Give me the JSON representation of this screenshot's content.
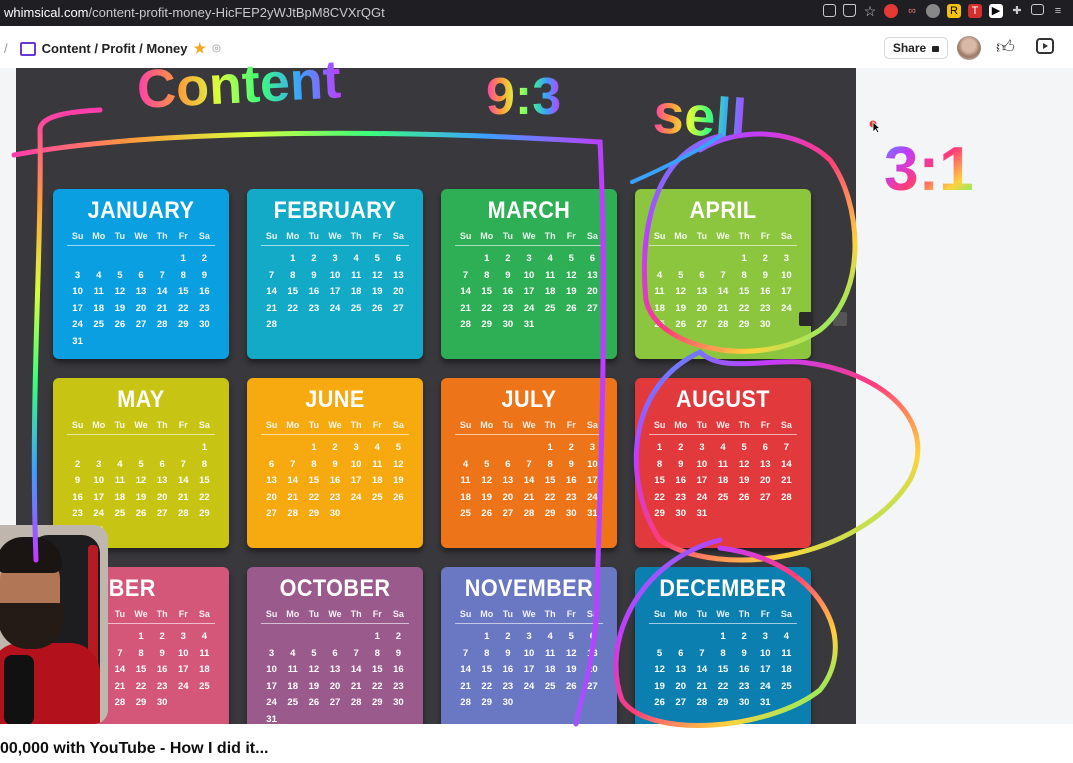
{
  "browser": {
    "url_host": "whimsical.com",
    "url_path": "/content-profit-money-HicFEP2yWJtBpM8CVXrQGt"
  },
  "toolbar": {
    "slash": "/",
    "breadcrumb": "Content / Profit / Money",
    "share_label": "Share"
  },
  "calendar": {
    "weekdays": [
      "Su",
      "Mo",
      "Tu",
      "We",
      "Th",
      "Fr",
      "Sa"
    ],
    "months": [
      {
        "name": "JANUARY",
        "color": "#0a9fe0",
        "offset": 5,
        "days": 31
      },
      {
        "name": "FEBRUARY",
        "color": "#12aac7",
        "offset": 1,
        "days": 28
      },
      {
        "name": "MARCH",
        "color": "#2eae55",
        "offset": 1,
        "days": 31
      },
      {
        "name": "APRIL",
        "color": "#8cc63e",
        "offset": 4,
        "days": 30
      },
      {
        "name": "MAY",
        "color": "#c8c414",
        "offset": 6,
        "days": 31
      },
      {
        "name": "JUNE",
        "color": "#f6aa10",
        "offset": 2,
        "days": 30
      },
      {
        "name": "JULY",
        "color": "#ee7419",
        "offset": 4,
        "days": 31
      },
      {
        "name": "AUGUST",
        "color": "#e2393d",
        "offset": 0,
        "days": 31
      },
      {
        "name": "SEPTEMBER",
        "name_visible": "PTEMBER",
        "color": "#d4577a",
        "offset": 3,
        "days": 30
      },
      {
        "name": "OCTOBER",
        "color": "#9a5b8c",
        "offset": 5,
        "days": 31
      },
      {
        "name": "NOVEMBER",
        "color": "#6a77c2",
        "offset": 1,
        "days": 30
      },
      {
        "name": "DECEMBER",
        "color": "#0b7fb0",
        "offset": 3,
        "days": 31
      }
    ]
  },
  "annotations": {
    "content_label": "Content",
    "content_ratio": "9:3",
    "sell_label": "sell",
    "sell_ratio": "3:1"
  },
  "video": {
    "title": "00,000 with YouTube - How I did it..."
  },
  "colors": {
    "page_bg": "#f4f5f7",
    "calendar_bg": "#39393d",
    "brand_purple": "#6b3ad6",
    "favorite_star": "#f0a823"
  }
}
